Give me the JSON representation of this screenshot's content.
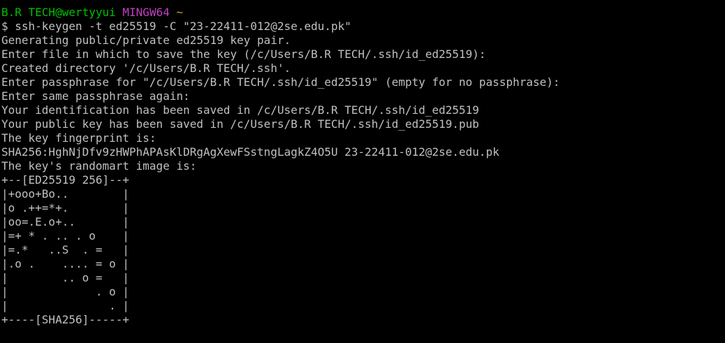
{
  "prompt": {
    "user_host": "B.R TECH@wertyyui",
    "system": "MINGW64",
    "cwd": "~"
  },
  "colors": {
    "background": "#000000",
    "text": "#c0c0c0",
    "user_host": "#00c000",
    "system": "#c040c0",
    "cwd": "#c0b000"
  },
  "lines": [
    "$ ssh-keygen -t ed25519 -C \"23-22411-012@2se.edu.pk\"",
    "Generating public/private ed25519 key pair.",
    "Enter file in which to save the key (/c/Users/B.R TECH/.ssh/id_ed25519):",
    "Created directory '/c/Users/B.R TECH/.ssh'.",
    "Enter passphrase for \"/c/Users/B.R TECH/.ssh/id_ed25519\" (empty for no passphrase):",
    "Enter same passphrase again:",
    "Your identification has been saved in /c/Users/B.R TECH/.ssh/id_ed25519",
    "Your public key has been saved in /c/Users/B.R TECH/.ssh/id_ed25519.pub",
    "The key fingerprint is:",
    "SHA256:HghNjDfv9zHWPhAPAsKlDRgAgXewFSstngLagkZ4O5U 23-22411-012@2se.edu.pk",
    "The key's randomart image is:",
    "+--[ED25519 256]--+",
    "|+ooo+Bo..        |",
    "|o .++=*+.        |",
    "|oo=.E.o+..       |",
    "|=+ * . .. . o    |",
    "|=.*   ..S  . =   |",
    "|.o .    .... = o |",
    "|        .. o =   |",
    "|             . o |",
    "|               . |",
    "+----[SHA256]-----+"
  ]
}
